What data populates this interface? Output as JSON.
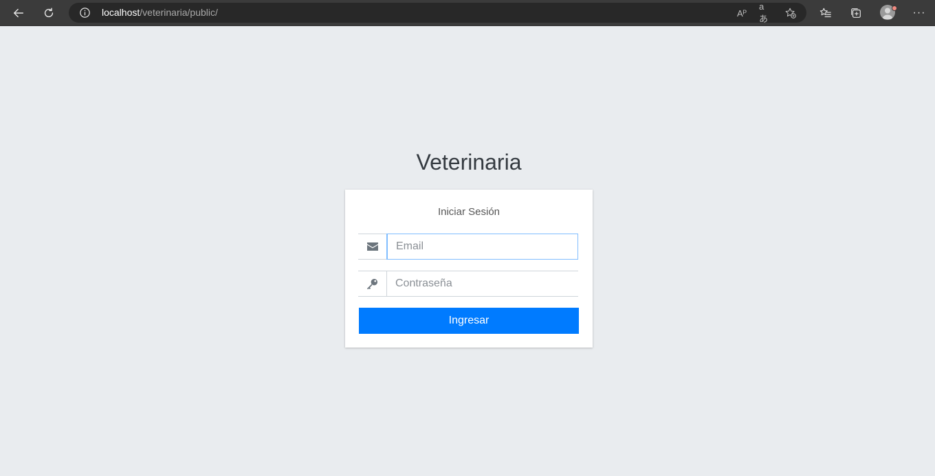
{
  "browser": {
    "url_host": "localhost",
    "url_path": "/veterinaria/public/",
    "icons": {
      "back": "back-arrow-icon",
      "reload": "reload-icon",
      "info": "info-icon",
      "read_aloud": "read-aloud-icon",
      "translate": "translate-icon",
      "add_favorite": "add-favorite-icon",
      "favorites": "favorites-icon",
      "collections": "collections-icon",
      "profile": "profile-avatar",
      "more": "more-icon"
    },
    "read_aloud_glyph": "Aᴾ",
    "translate_glyph": "aあ",
    "more_glyph": "···"
  },
  "login": {
    "title": "Veterinaria",
    "subtitle": "Iniciar Sesión",
    "email_placeholder": "Email",
    "password_placeholder": "Contraseña",
    "submit_label": "Ingresar"
  },
  "colors": {
    "page_bg": "#e9ecef",
    "primary": "#007bff",
    "focus_border": "#80bdff"
  }
}
